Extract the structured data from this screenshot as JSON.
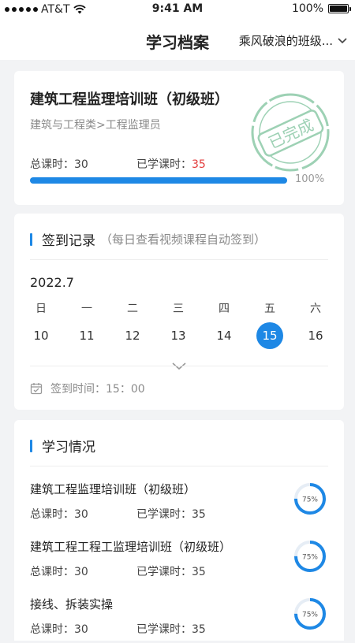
{
  "status_bar": {
    "carrier": "AT&T",
    "time": "9:41 AM",
    "battery": "100%",
    "battery_level": 1.0
  },
  "header": {
    "title": "学习档案",
    "class_selector": "乘风破浪的班级..."
  },
  "course_card": {
    "title": "建筑工程监理培训班（初级班）",
    "category": "建筑与工程类>工程监理员",
    "total_hours_label": "总课时：",
    "total_hours": "30",
    "learned_hours_label": "已学课时：",
    "learned_hours": "35",
    "progress": 1.0,
    "progress_text": "100%",
    "stamp_text": "已完成",
    "accent": "#1e88e5",
    "stamp_color": "#8cc9a8"
  },
  "checkin": {
    "title": "签到记录",
    "note": "（每日查看视频课程自动签到）",
    "month": "2022.7",
    "weekdays": [
      "日",
      "一",
      "二",
      "三",
      "四",
      "五",
      "六"
    ],
    "days": [
      "10",
      "11",
      "12",
      "13",
      "14",
      "15",
      "16"
    ],
    "selected_day": "15",
    "checkin_time": "签到时间：15：00"
  },
  "study": {
    "title": "学习情况",
    "items": [
      {
        "name": "建筑工程监理培训班（初级班）",
        "total_label": "总课时：",
        "total": "30",
        "learned_label": "已学课时：",
        "learned": "35",
        "percent": "75%",
        "progress": 0.75
      },
      {
        "name": "建筑工程工程工监理培训班（初级班）",
        "total_label": "总课时：",
        "total": "30",
        "learned_label": "已学课时：",
        "learned": "35",
        "percent": "75%",
        "progress": 0.75
      },
      {
        "name": "接线、拆装实操",
        "total_label": "总课时：",
        "total": "30",
        "learned_label": "已学课时：",
        "learned": "35",
        "percent": "75%",
        "progress": 0.75
      }
    ]
  }
}
